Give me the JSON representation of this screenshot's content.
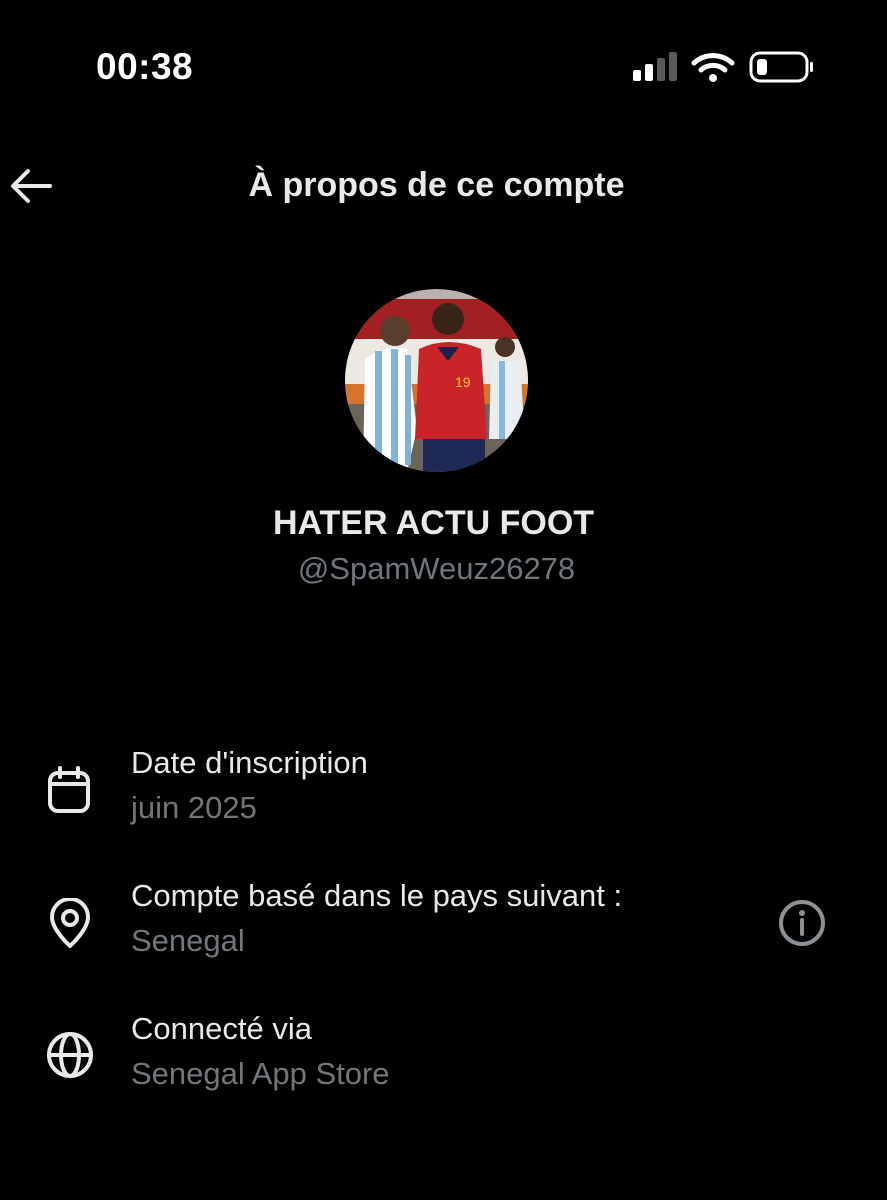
{
  "status_bar": {
    "time": "00:38",
    "icons": [
      "signal-icon",
      "wifi-icon",
      "battery-icon"
    ]
  },
  "header": {
    "back_icon": "arrow-left-icon",
    "title": "À propos de ce compte"
  },
  "profile": {
    "display_name": "HATER ACTU FOOT",
    "handle": "@SpamWeuz26278",
    "avatar_jersey_number": "19"
  },
  "details": [
    {
      "icon": "calendar-icon",
      "label": "Date d'inscription",
      "value": "juin 2025"
    },
    {
      "icon": "location-pin-icon",
      "label": "Compte basé dans le pays suivant :",
      "value": "Senegal",
      "action_icon": "info-icon"
    },
    {
      "icon": "globe-icon",
      "label": "Connecté via",
      "value": "Senegal App Store"
    }
  ],
  "colors": {
    "background": "#000000",
    "primary_text": "#e7e9ea",
    "secondary_text": "#71767b"
  }
}
